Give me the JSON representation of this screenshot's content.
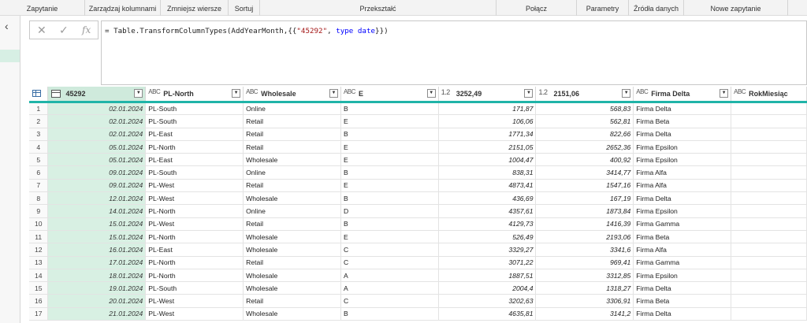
{
  "ribbon": {
    "groups": [
      "Zapytanie",
      "Zarządzaj kolumnami",
      "Zmniejsz wiersze",
      "Sortuj",
      "Przekształć",
      "Połącz",
      "Parametry",
      "Źródła danych",
      "Nowe zapytanie"
    ]
  },
  "formula": {
    "prefix": "= Table.TransformColumnTypes(AddYearMonth,{{",
    "string": "\"45292\"",
    "mid": ", ",
    "keyword1": "type",
    "space": " ",
    "keyword2": "date",
    "suffix": "}})",
    "cancel_icon": "x-icon",
    "confirm_icon": "checkmark-icon",
    "fx_label": "fx"
  },
  "grid": {
    "columns": [
      {
        "type_icon": "calendar-icon",
        "type_label": "",
        "name": "45292"
      },
      {
        "type_icon": "text-type-icon",
        "type_label": "ABC",
        "name": "PL-North"
      },
      {
        "type_icon": "text-type-icon",
        "type_label": "ABC",
        "name": "Wholesale"
      },
      {
        "type_icon": "text-type-icon",
        "type_label": "ABC",
        "name": "E"
      },
      {
        "type_icon": "decimal-type-icon",
        "type_label": "1.2",
        "name": "3252,49"
      },
      {
        "type_icon": "decimal-type-icon",
        "type_label": "1.2",
        "name": "2151,06"
      },
      {
        "type_icon": "text-type-icon",
        "type_label": "ABC",
        "name": "Firma Delta"
      },
      {
        "type_icon": "text-type-icon",
        "type_label": "ABC",
        "name": "RokMiesiąc"
      }
    ],
    "rows": [
      [
        "1",
        "02.01.2024",
        "PL-South",
        "Online",
        "B",
        "171,87",
        "568,83",
        "Firma Delta",
        ""
      ],
      [
        "2",
        "02.01.2024",
        "PL-South",
        "Retail",
        "E",
        "106,06",
        "562,81",
        "Firma Beta",
        ""
      ],
      [
        "3",
        "02.01.2024",
        "PL-East",
        "Retail",
        "B",
        "1771,34",
        "822,66",
        "Firma Delta",
        ""
      ],
      [
        "4",
        "05.01.2024",
        "PL-North",
        "Retail",
        "E",
        "2151,05",
        "2652,36",
        "Firma Epsilon",
        ""
      ],
      [
        "5",
        "05.01.2024",
        "PL-East",
        "Wholesale",
        "E",
        "1004,47",
        "400,92",
        "Firma Epsilon",
        ""
      ],
      [
        "6",
        "09.01.2024",
        "PL-South",
        "Online",
        "B",
        "838,31",
        "3414,77",
        "Firma Alfa",
        ""
      ],
      [
        "7",
        "09.01.2024",
        "PL-West",
        "Retail",
        "E",
        "4873,41",
        "1547,16",
        "Firma Alfa",
        ""
      ],
      [
        "8",
        "12.01.2024",
        "PL-West",
        "Wholesale",
        "B",
        "436,69",
        "167,19",
        "Firma Delta",
        ""
      ],
      [
        "9",
        "14.01.2024",
        "PL-North",
        "Online",
        "D",
        "4357,61",
        "1873,84",
        "Firma Epsilon",
        ""
      ],
      [
        "10",
        "15.01.2024",
        "PL-West",
        "Retail",
        "B",
        "4129,73",
        "1416,39",
        "Firma Gamma",
        ""
      ],
      [
        "11",
        "15.01.2024",
        "PL-North",
        "Wholesale",
        "E",
        "526,49",
        "2193,06",
        "Firma Beta",
        ""
      ],
      [
        "12",
        "16.01.2024",
        "PL-East",
        "Wholesale",
        "C",
        "3329,27",
        "3341,6",
        "Firma Alfa",
        ""
      ],
      [
        "13",
        "17.01.2024",
        "PL-North",
        "Retail",
        "C",
        "3071,22",
        "969,41",
        "Firma Gamma",
        ""
      ],
      [
        "14",
        "18.01.2024",
        "PL-North",
        "Wholesale",
        "A",
        "1887,51",
        "3312,85",
        "Firma Epsilon",
        ""
      ],
      [
        "15",
        "19.01.2024",
        "PL-South",
        "Wholesale",
        "A",
        "2004,4",
        "1318,27",
        "Firma Delta",
        ""
      ],
      [
        "16",
        "20.01.2024",
        "PL-West",
        "Retail",
        "C",
        "3202,63",
        "3306,91",
        "Firma Beta",
        ""
      ],
      [
        "17",
        "21.01.2024",
        "PL-West",
        "Wholesale",
        "B",
        "4635,81",
        "3141,2",
        "Firma Delta",
        ""
      ]
    ]
  },
  "colors": {
    "accent": "#20b4a8",
    "selected_column": "#d8f0e3",
    "formula_string": "#a31515",
    "formula_keyword": "#0000ff"
  }
}
